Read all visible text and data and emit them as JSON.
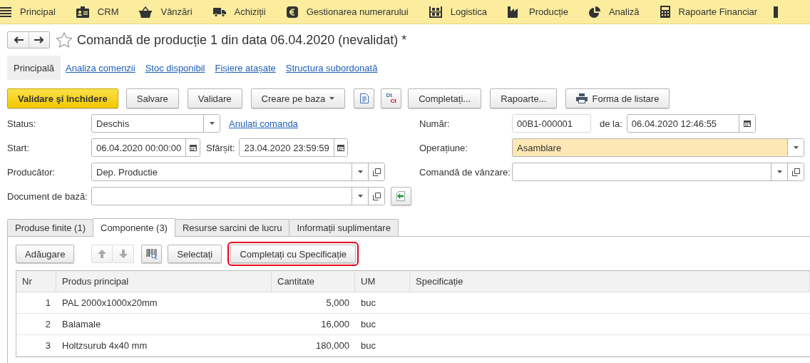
{
  "menu": [
    {
      "label": "Principal"
    },
    {
      "label": "CRM"
    },
    {
      "label": "Vânzări"
    },
    {
      "label": "Achiziții"
    },
    {
      "label": "Gestionarea numerarului"
    },
    {
      "label": "Logistica"
    },
    {
      "label": "Producție"
    },
    {
      "label": "Analiză"
    },
    {
      "label": "Rapoarte Financiar"
    }
  ],
  "favorite": false,
  "title": "Comandă de producție 1 din data 06.04.2020 (nevalidat) *",
  "page_tabs": [
    {
      "label": "Principală",
      "selected": true
    },
    {
      "label": "Analiza comenzii",
      "selected": false
    },
    {
      "label": "Stoc disponibil",
      "selected": false
    },
    {
      "label": "Fișiere atașate",
      "selected": false
    },
    {
      "label": "Structura subordonată",
      "selected": false
    }
  ],
  "toolbar": [
    {
      "kind": "primary",
      "label": "Validare şi închidere"
    },
    {
      "kind": "button",
      "label": "Salvare"
    },
    {
      "kind": "button",
      "label": "Validare"
    },
    {
      "kind": "dropdown",
      "label": "Creare pe baza"
    },
    {
      "kind": "report"
    },
    {
      "kind": "dtct",
      "top": "Dt",
      "bottom": "Ct"
    },
    {
      "kind": "button",
      "label": "Completați..."
    },
    {
      "kind": "button",
      "label": "Rapoarte..."
    },
    {
      "kind": "print",
      "label": "Forma de listare"
    }
  ],
  "form_left": [
    {
      "label": "Status:",
      "items": [
        {
          "kind": "select",
          "value": "Deschis"
        },
        {
          "kind": "link",
          "text": "Anulați comanda"
        }
      ]
    },
    {
      "label": "Start:",
      "items": [
        {
          "kind": "date",
          "value": "06.04.2020 00:00:00"
        },
        {
          "kind": "label",
          "text": "Sfârșit:"
        },
        {
          "kind": "date",
          "value": "23.04.2020 23:59:59"
        }
      ]
    },
    {
      "label": "Producător:",
      "items": [
        {
          "kind": "ref",
          "value": "Dep. Productie"
        }
      ]
    },
    {
      "label": "Document de bază:",
      "items": [
        {
          "kind": "ref"
        },
        {
          "kind": "fill"
        }
      ]
    }
  ],
  "form_right": [
    {
      "label": "Număr:",
      "items": [
        {
          "kind": "text",
          "value": "00B1-000001"
        },
        {
          "kind": "label",
          "text": "de la:"
        },
        {
          "kind": "date",
          "value": "06.04.2020 12:46:55"
        }
      ]
    },
    {
      "label": "Operațiune:",
      "items": [
        {
          "kind": "select",
          "value": "Asamblare",
          "highlighted": true
        }
      ]
    },
    {
      "label": "Comandă de vânzare:",
      "items": [
        {
          "kind": "ref"
        }
      ]
    }
  ],
  "doc_tabs": [
    {
      "label": "Produse finite (1)",
      "selected": false
    },
    {
      "label": "Componente (3)",
      "selected": true
    },
    {
      "label": "Resurse sarcini de lucru",
      "selected": false
    },
    {
      "label": "Informații suplimentare",
      "selected": false
    }
  ],
  "table_toolbar": [
    {
      "kind": "button",
      "label": "Adăugare"
    },
    {
      "kind": "move",
      "disabled": true
    },
    {
      "kind": "barcode"
    },
    {
      "kind": "button",
      "label": "Selectați"
    },
    {
      "kind": "button",
      "label": "Completați cu Specificație",
      "highlighted": true
    }
  ],
  "table": {
    "columns": [
      "Nr",
      "Produs principal",
      "Cantitate",
      "UM",
      "Specificație"
    ],
    "rows": [
      {
        "nr": "1",
        "product": "PAL 2000x1000x20mm",
        "quantity": "5,000",
        "unit": "buc"
      },
      {
        "nr": "2",
        "product": "Balamale",
        "quantity": "16,000",
        "unit": "buc"
      },
      {
        "nr": "3",
        "product": "Holtzsurub 4x40 mm",
        "quantity": "180,000",
        "unit": "buc"
      }
    ]
  }
}
